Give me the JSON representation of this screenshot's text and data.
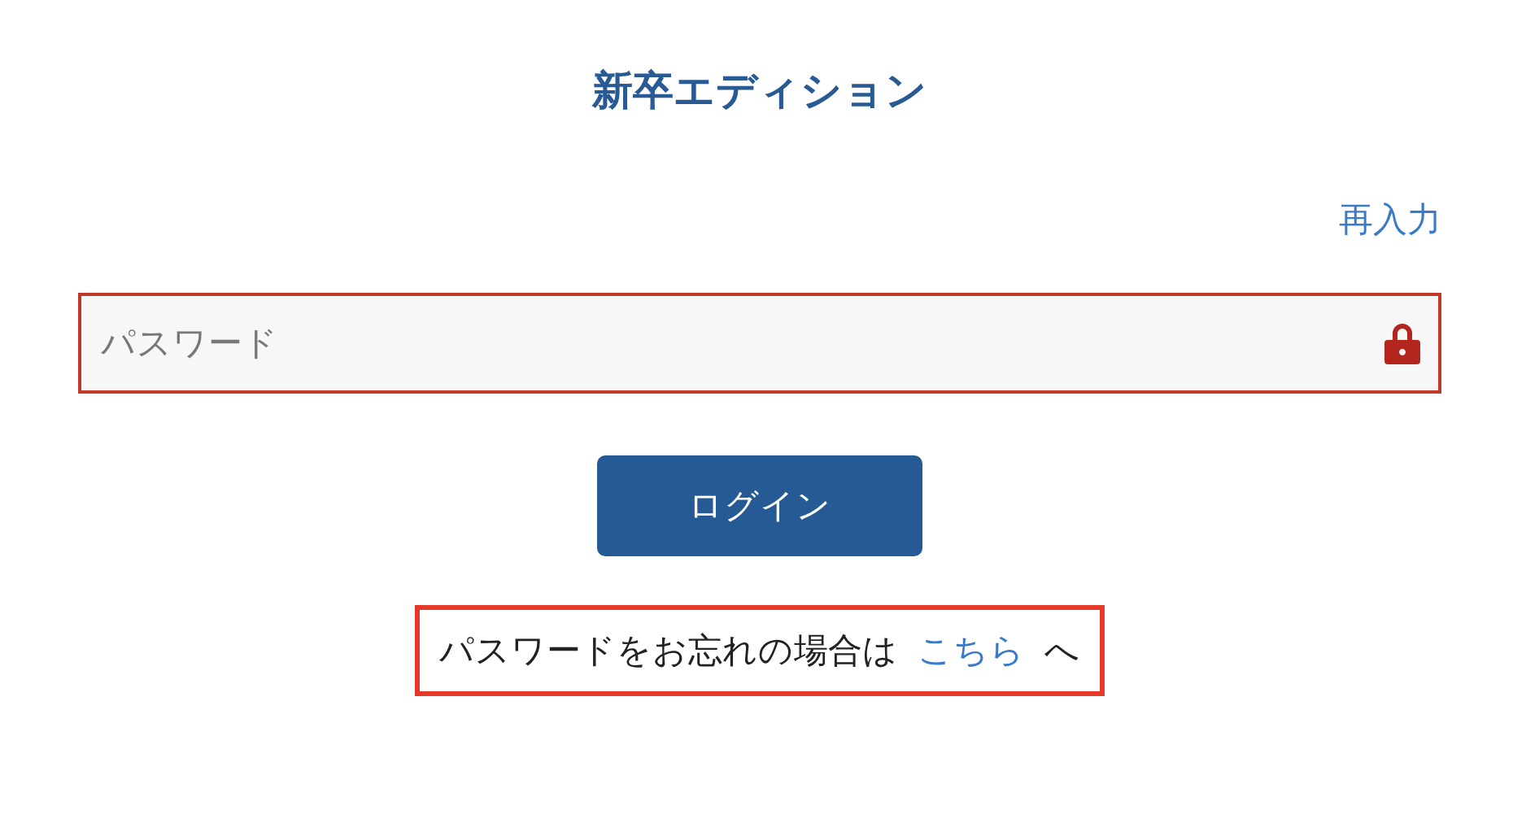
{
  "title": "新卒エディション",
  "reenter_link": "再入力",
  "password_field": {
    "placeholder": "パスワード",
    "invalid": true
  },
  "login_button": "ログイン",
  "forgot": {
    "highlighted": true,
    "text": "パスワードをお忘れの場合は",
    "link": "こちら",
    "suffix": "へ"
  }
}
